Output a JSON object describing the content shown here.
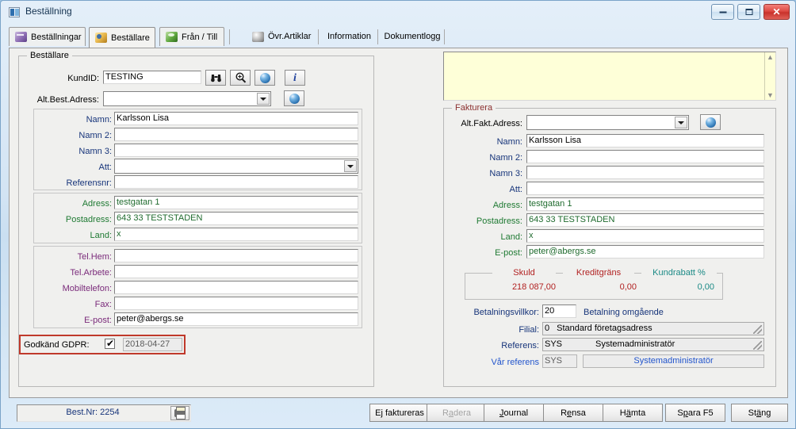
{
  "window": {
    "title": "Beställning",
    "controls": {
      "minimize": "minimize-button",
      "maximize": "maximize-button",
      "close": "✕"
    }
  },
  "tabs": [
    {
      "label": "Beställningar",
      "icon": "orders-icon",
      "active": false
    },
    {
      "label": "Beställare",
      "icon": "customer-icon",
      "active": true
    },
    {
      "label": "Från / Till",
      "icon": "fromto-icon",
      "active": false
    },
    {
      "label": "Övr.Artiklar",
      "icon": "sphere-icon",
      "active": false
    },
    {
      "label": "Information",
      "icon": "",
      "active": false
    },
    {
      "label": "Dokumentlogg",
      "icon": "",
      "active": false
    }
  ],
  "left": {
    "group_title": "Beställare",
    "kundid": {
      "label": "KundID:",
      "value": "TESTING"
    },
    "toolbuttons": [
      {
        "name": "binoculars-search-button",
        "glyph": "binoculars-icon"
      },
      {
        "name": "zoom-lookup-button",
        "glyph": "magnifier-icon"
      },
      {
        "name": "web-lookup-button",
        "glyph": "globe-icon"
      },
      {
        "name": "info-button",
        "glyph": "info-icon"
      }
    ],
    "alt_address": {
      "label": "Alt.Best.Adress:",
      "value": ""
    },
    "name_fields": [
      {
        "label": "Namn:",
        "value": "Karlsson Lisa",
        "color": "navy"
      },
      {
        "label": "Namn 2:",
        "value": "",
        "color": "navy"
      },
      {
        "label": "Namn 3:",
        "value": "",
        "color": "navy"
      },
      {
        "label": "Att:",
        "value": "",
        "color": "navy",
        "combo": true
      },
      {
        "label": "Referensnr:",
        "value": "",
        "color": "navy"
      }
    ],
    "address_fields": [
      {
        "label": "Adress:",
        "value": "testgatan 1",
        "color": "green"
      },
      {
        "label": "Postadress:",
        "value": "643 33 TESTSTADEN",
        "color": "green"
      },
      {
        "label": "Land:",
        "value": "x",
        "color": "green"
      }
    ],
    "contact_fields": [
      {
        "label": "Tel.Hem:",
        "value": "",
        "color": "purple"
      },
      {
        "label": "Tel.Arbete:",
        "value": "",
        "color": "purple"
      },
      {
        "label": "Mobiltelefon:",
        "value": "",
        "color": "purple"
      },
      {
        "label": "Fax:",
        "value": "",
        "color": "purple"
      },
      {
        "label": "E-post:",
        "value": "peter@abergs.se",
        "color": "purple"
      }
    ],
    "gdpr": {
      "label": "Godkänd GDPR:",
      "checked": true,
      "date": "2018-04-27",
      "highlight_color": "#c0392b"
    }
  },
  "right": {
    "notes": {
      "value": "",
      "background": "#feffd8"
    },
    "group_title": "Fakturera",
    "alt_fakt": {
      "label": "Alt.Fakt.Adress:",
      "value": ""
    },
    "fields": [
      {
        "label": "Namn:",
        "value": "Karlsson Lisa",
        "color": "navy"
      },
      {
        "label": "Namn 2:",
        "value": "",
        "color": "navy"
      },
      {
        "label": "Namn 3:",
        "value": "",
        "color": "navy"
      },
      {
        "label": "Att:",
        "value": "",
        "color": "navy"
      },
      {
        "label": "Adress:",
        "value": "testgatan 1",
        "color": "green"
      },
      {
        "label": "Postadress:",
        "value": "643 33 TESTSTADEN",
        "color": "green"
      },
      {
        "label": "Land:",
        "value": "x",
        "color": "green"
      },
      {
        "label": "E-post:",
        "value": "peter@abergs.se",
        "color": "green"
      }
    ],
    "money": {
      "headers": [
        {
          "label": "Skuld",
          "color": "#b22222"
        },
        {
          "label": "Kreditgräns",
          "color": "#b22222"
        },
        {
          "label": "Kundrabatt %",
          "color": "#1b8a86"
        }
      ],
      "values": [
        {
          "value": "218 087,00",
          "color": "#b22222"
        },
        {
          "value": "0,00",
          "color": "#b22222"
        },
        {
          "value": "0,00",
          "color": "#1b8a86"
        }
      ]
    },
    "payment": {
      "label": "Betalningsvillkor:",
      "code": "20",
      "text": "Betalning omgående"
    },
    "filial": {
      "label": "Filial:",
      "code": "0",
      "text": "Standard företagsadress"
    },
    "referens": {
      "label": "Referens:",
      "code": "SYS",
      "text": "Systemadministratör"
    },
    "var_referens": {
      "label": "Vår referens",
      "code": "SYS",
      "text": "Systemadministratör"
    }
  },
  "statusbar": {
    "order_label": "Best.Nr: 2254",
    "print_icon": "printer-icon"
  },
  "buttons": [
    {
      "label": "Ej faktureras",
      "mnemonic": "j",
      "disabled": false,
      "name": "not-invoiced-button"
    },
    {
      "label": "Radera",
      "mnemonic": "a",
      "disabled": true,
      "name": "delete-button"
    },
    {
      "label": "Journal",
      "mnemonic": "J",
      "disabled": false,
      "name": "journal-button"
    },
    {
      "label": "Rensa",
      "mnemonic": "e",
      "disabled": false,
      "name": "clear-button"
    },
    {
      "label": "Hämta",
      "mnemonic": "ä",
      "disabled": false,
      "name": "fetch-button"
    },
    {
      "label": "Spara F5",
      "mnemonic": "p",
      "disabled": false,
      "name": "save-button"
    },
    {
      "label": "Stäng",
      "mnemonic": "ä",
      "disabled": false,
      "name": "close-dialog-button"
    }
  ]
}
